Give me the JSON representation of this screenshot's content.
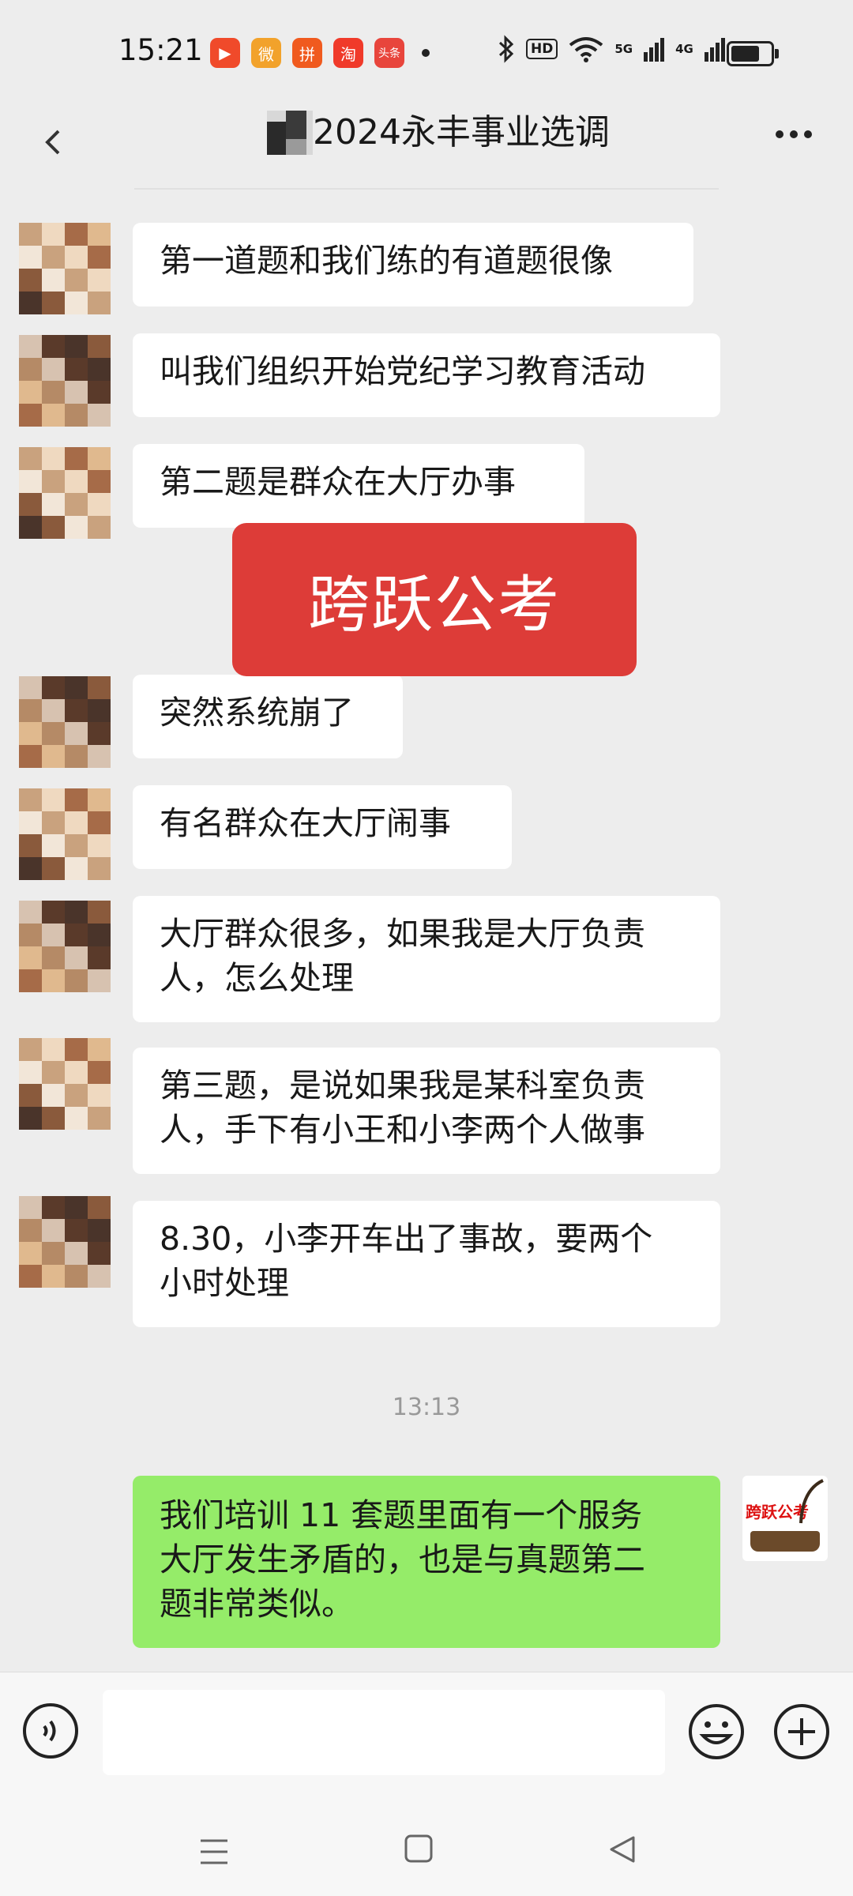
{
  "status_bar": {
    "time": "15:21",
    "app_icons": [
      {
        "name": "video-app-icon",
        "glyph": "▶",
        "color": "#f04a2a"
      },
      {
        "name": "weibo-icon",
        "glyph": "微",
        "color": "#f2a22b"
      },
      {
        "name": "pinduoduo-icon",
        "glyph": "拼",
        "color": "#f05a1e"
      },
      {
        "name": "taobao-icon",
        "glyph": "淘",
        "color": "#f03a2a"
      },
      {
        "name": "toutiao-icon",
        "glyph": "头条",
        "color": "#e8453c"
      }
    ],
    "hd_label": "HD",
    "network_5g": "5G",
    "network_4g": "4G",
    "battery_level": 0.72
  },
  "header": {
    "title": "2024永丰事业选调"
  },
  "messages": [
    {
      "text": "第一道题和我们练的有道题很像"
    },
    {
      "text": "叫我们组织开始党纪学习教育活动"
    },
    {
      "text": "第二题是群众在大厅办事"
    },
    {
      "text": "突然系统崩了"
    },
    {
      "text": "有名群众在大厅闹事"
    },
    {
      "text": "大厅群众很多，如果我是大厅负责\n人，怎么处理"
    },
    {
      "text": "第三题，是说如果我是某科室负责\n人，手下有小王和小李两个人做事"
    },
    {
      "text": "8.30，小李开车出了事故，要两个\n小时处理"
    }
  ],
  "watermark": "跨跃公考",
  "timestamp": "13:13",
  "my_message": {
    "text": "我们培训 11 套题里面有一个服务\n大厅发生矛盾的，也是与真题第二\n题非常类似。",
    "avatar_text": "跨跃公考"
  },
  "input": {
    "value": "",
    "placeholder": ""
  },
  "colors": {
    "background": "#ededed",
    "my_bubble": "#95ec69",
    "watermark": "#dd3c38"
  }
}
